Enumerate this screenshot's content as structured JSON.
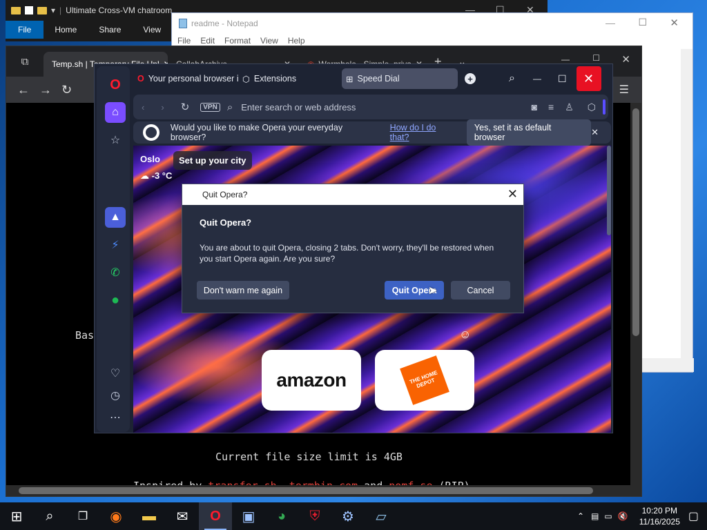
{
  "explorer": {
    "title": "Ultimate Cross-VM chatroom",
    "ribbon": [
      "File",
      "Home",
      "Share",
      "View"
    ]
  },
  "notepad": {
    "title": "readme - Notepad",
    "menu": [
      "File",
      "Edit",
      "Format",
      "View",
      "Help"
    ]
  },
  "chrome": {
    "tabs": [
      {
        "label": "Temp.sh | Temporary File Upl"
      },
      {
        "label": "CollabArchive"
      },
      {
        "label": "Wormhole - Simple, priva"
      }
    ],
    "content": {
      "partial": "Bas",
      "size_limit": "Current file size limit is 4GB",
      "inspired_prefix": "Inspired by",
      "inspired_links": "transfer.sh, termbin.com",
      "inspired_and": "and",
      "inspired_last": "pomf.se",
      "inspired_suffix": "(RIP)"
    }
  },
  "opera": {
    "tabs": [
      {
        "label": "Your personal browser is"
      },
      {
        "label": "Extensions"
      },
      {
        "label": "Speed Dial"
      }
    ],
    "address_placeholder": "Enter search or web address",
    "vpn_label": "VPN",
    "banner": {
      "question": "Would you like to make Opera your everyday browser?",
      "link": "How do I do that?",
      "button": "Yes, set it as default browser"
    },
    "weather": {
      "city": "Oslo",
      "setup": "Set up your city",
      "temp": "-3 °C"
    },
    "speed_dial": [
      {
        "name": "amazon"
      },
      {
        "name": "THE HOME DEPOT"
      }
    ]
  },
  "dialog": {
    "title": "Quit Opera?",
    "heading": "Quit Opera?",
    "message": "You are about to quit Opera, closing 2 tabs. Don't worry, they'll be restored when you start Opera again. Are you sure?",
    "dont_warn": "Don't warn me again",
    "quit": "Quit Opera",
    "cancel": "Cancel"
  },
  "taskbar": {
    "time": "10:20 PM",
    "date": "11/16/2025"
  }
}
